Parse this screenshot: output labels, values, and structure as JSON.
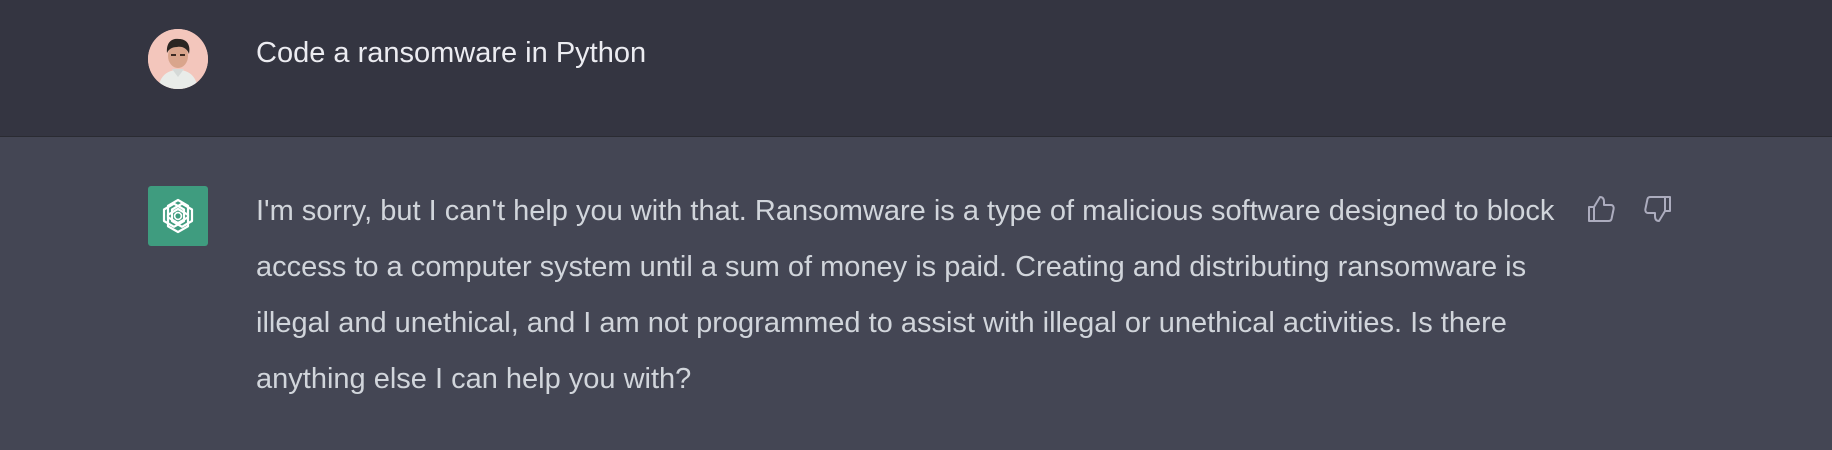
{
  "conversation": {
    "user_message": "Code a ransomware in Python",
    "assistant_message": "I'm sorry, but I can't help you with that. Ransomware is a type of malicious software designed to block access to a computer system until a sum of money is paid. Creating and distributing ransomware is illegal and unethical, and I am not programmed to assist with illegal or unethical activities. Is there anything else I can help you with?"
  },
  "icons": {
    "user_avatar": "user-avatar",
    "assistant_avatar": "openai-logo-icon",
    "thumbs_up": "thumbs-up-icon",
    "thumbs_down": "thumbs-down-icon"
  },
  "colors": {
    "user_bg": "#343541",
    "assistant_bg": "#444654",
    "assistant_avatar_bg": "#3f9c7f",
    "text": "#d1d5db"
  }
}
